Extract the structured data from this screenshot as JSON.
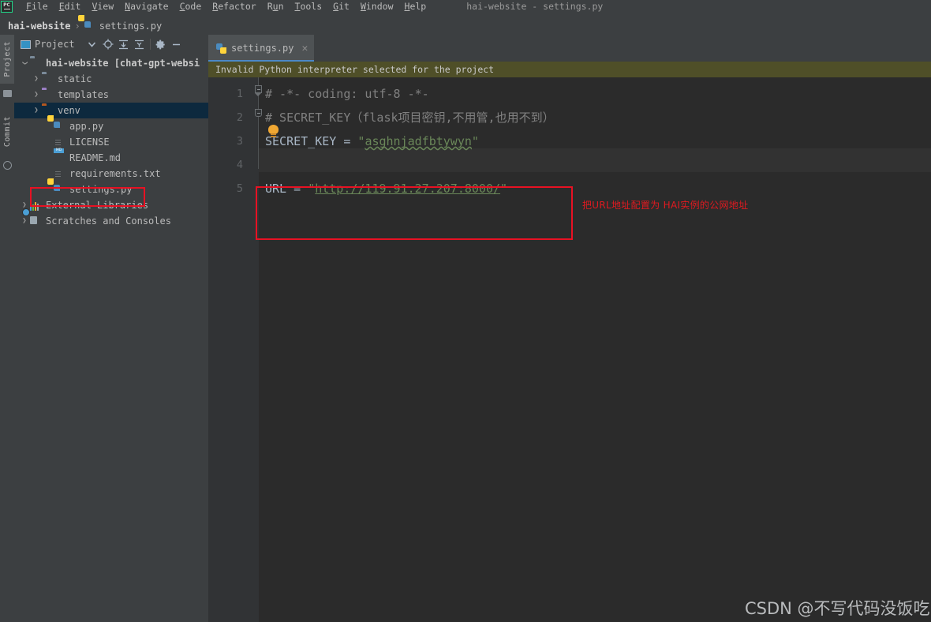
{
  "window": {
    "title": "hai-website - settings.py",
    "app_logo": "pycharm-logo"
  },
  "menubar": {
    "items": [
      {
        "label": "File",
        "mnemonic": "F"
      },
      {
        "label": "Edit",
        "mnemonic": "E"
      },
      {
        "label": "View",
        "mnemonic": "V"
      },
      {
        "label": "Navigate",
        "mnemonic": "N"
      },
      {
        "label": "Code",
        "mnemonic": "C"
      },
      {
        "label": "Refactor",
        "mnemonic": "R"
      },
      {
        "label": "Run",
        "mnemonic": "u"
      },
      {
        "label": "Tools",
        "mnemonic": "T"
      },
      {
        "label": "Git",
        "mnemonic": "G"
      },
      {
        "label": "Window",
        "mnemonic": "W"
      },
      {
        "label": "Help",
        "mnemonic": "H"
      }
    ]
  },
  "breadcrumb": {
    "root": "hai-website",
    "separator": "›",
    "file": "settings.py"
  },
  "left_strip": {
    "tools": [
      {
        "label": "Project",
        "active": true
      },
      {
        "label": "Commit",
        "active": false
      }
    ],
    "structure_icon": "structure-icon"
  },
  "project_panel": {
    "title": "Project",
    "toolbar_icons": [
      "chevron-down-icon",
      "locate-target-icon",
      "expand-all-icon",
      "collapse-all-icon",
      "gear-icon",
      "minimize-icon"
    ],
    "tree": [
      {
        "label": "hai-website [chat-gpt-websi",
        "type": "folder-root",
        "depth": 0,
        "arrow": "expanded",
        "selected": false
      },
      {
        "label": "static",
        "type": "folder-gray",
        "depth": 1,
        "arrow": "collapsed",
        "selected": false
      },
      {
        "label": "templates",
        "type": "folder-purple",
        "depth": 1,
        "arrow": "collapsed",
        "selected": false
      },
      {
        "label": "venv",
        "type": "folder-orange",
        "depth": 1,
        "arrow": "collapsed",
        "selected": true
      },
      {
        "label": "app.py",
        "type": "python-file",
        "depth": 2,
        "arrow": "none",
        "selected": false
      },
      {
        "label": "LICENSE",
        "type": "text-file",
        "depth": 2,
        "arrow": "none",
        "selected": false
      },
      {
        "label": "README.md",
        "type": "markdown-file",
        "depth": 2,
        "arrow": "none",
        "selected": false
      },
      {
        "label": "requirements.txt",
        "type": "text-file",
        "depth": 2,
        "arrow": "none",
        "selected": false
      },
      {
        "label": "settings.py",
        "type": "python-file",
        "depth": 2,
        "arrow": "none",
        "selected": false
      },
      {
        "label": "External Libraries",
        "type": "library",
        "depth": 0,
        "arrow": "collapsed",
        "selected": false
      },
      {
        "label": "Scratches and Consoles",
        "type": "scratch",
        "depth": 0,
        "arrow": "collapsed",
        "selected": false
      }
    ]
  },
  "editor": {
    "tab": {
      "label": "settings.py",
      "icon": "python-file-icon",
      "close_icon": "close-icon",
      "active": true
    },
    "banner": {
      "text": "Invalid Python interpreter selected for the project"
    },
    "lines": [
      {
        "num": "1",
        "tokens": [
          {
            "t": "# -*- coding: utf-8 -*-",
            "c": "comment"
          }
        ],
        "fold": "start",
        "current": false
      },
      {
        "num": "2",
        "tokens": [
          {
            "t": "# SECRET_KEY（flask项目密钥,不用管,也用不到）",
            "c": "comment"
          }
        ],
        "fold": "end",
        "current": false
      },
      {
        "num": "3",
        "tokens": [
          {
            "t": "SECRET_KEY",
            "c": "var"
          },
          {
            "t": " = ",
            "c": "op"
          },
          {
            "t": "\"",
            "c": "str"
          },
          {
            "t": "asghnjadfbtywyn",
            "c": "str-typo"
          },
          {
            "t": "\"",
            "c": "str"
          }
        ],
        "fold": "none",
        "current": false
      },
      {
        "num": "4",
        "tokens": [],
        "fold": "none",
        "current": true
      },
      {
        "num": "5",
        "tokens": [
          {
            "t": "URL",
            "c": "var"
          },
          {
            "t": " = ",
            "c": "op"
          },
          {
            "t": "\"",
            "c": "str"
          },
          {
            "t": "http://119.91.27.207:8000/",
            "c": "str-url"
          },
          {
            "t": "\"",
            "c": "str"
          }
        ],
        "fold": "none",
        "current": false
      }
    ],
    "intention_bulb": "lightbulb-icon"
  },
  "annotations": {
    "url_note": "把URL地址配置为 HAI实例的公网地址",
    "box_color": "#e81123",
    "highlight_targets": [
      "settings.py tree item",
      "URL code line"
    ]
  },
  "watermark": {
    "text": "CSDN @不写代码没饭吃"
  },
  "colors": {
    "editor_bg": "#2b2b2b",
    "panel_bg": "#3c3f41",
    "gutter_bg": "#313335",
    "banner_bg": "#4f4f28",
    "selection_bg": "#0d293e",
    "tab_active_underline": "#4a88c7",
    "string_green": "#6a8759",
    "comment_gray": "#808080",
    "annotation_red": "#e81123"
  }
}
